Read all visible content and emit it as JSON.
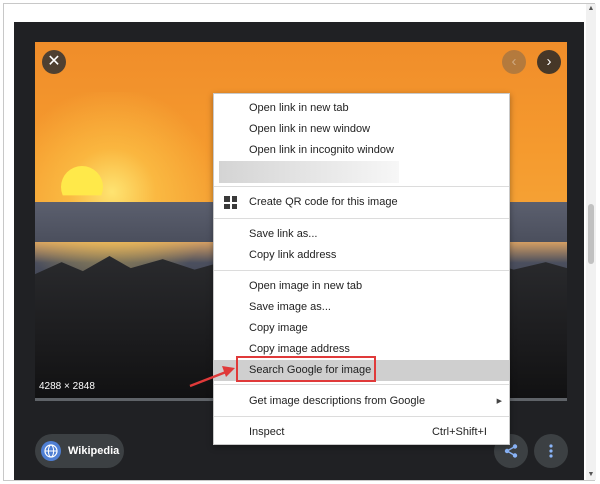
{
  "viewer": {
    "image_dimensions": "4288 × 2848",
    "close_icon": "close-icon",
    "prev_icon": "chevron-left-icon",
    "next_icon": "chevron-right-icon",
    "source": {
      "label": "Wikipedia",
      "icon": "globe-icon"
    },
    "share_icon": "share-icon",
    "more_icon": "more-vertical-icon"
  },
  "context_menu": {
    "open_link_new_tab": "Open link in new tab",
    "open_link_new_window": "Open link in new window",
    "open_link_incognito": "Open link in incognito window",
    "create_qr": "Create QR code for this image",
    "qr_icon": "qr-code-icon",
    "save_link_as": "Save link as...",
    "copy_link_address": "Copy link address",
    "open_image_new_tab": "Open image in new tab",
    "save_image_as": "Save image as...",
    "copy_image": "Copy image",
    "copy_image_address": "Copy image address",
    "search_google_image": "Search Google for image",
    "get_image_descriptions": "Get image descriptions from Google",
    "inspect": "Inspect",
    "inspect_shortcut": "Ctrl+Shift+I"
  },
  "colors": {
    "annotation_red": "#e03a3a",
    "panel_background": "#202124",
    "menu_highlight": "#cfcfcf"
  }
}
